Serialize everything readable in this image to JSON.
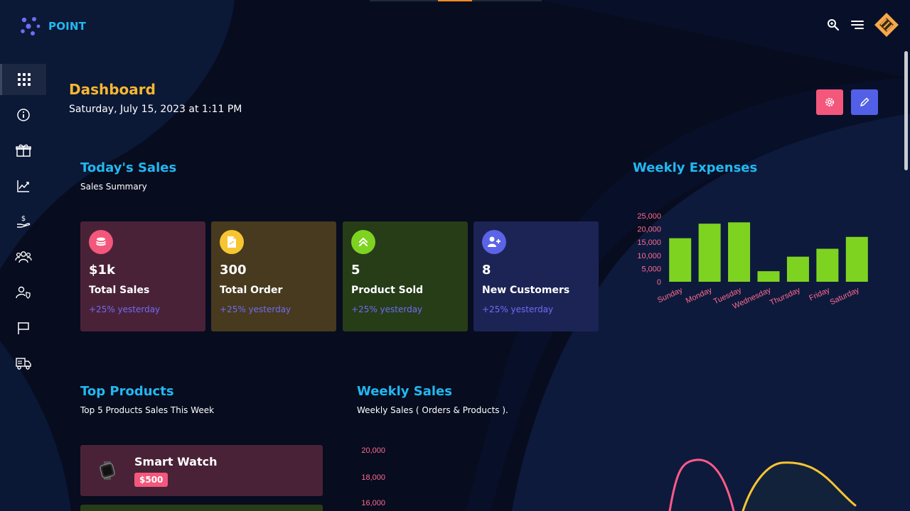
{
  "brand": {
    "name": "POINT"
  },
  "header": {
    "icons": [
      "search-icon",
      "menu-icon",
      "avatar-logo"
    ]
  },
  "sidebar": {
    "items": [
      {
        "icon": "grid-icon",
        "active": true
      },
      {
        "icon": "info-icon",
        "active": false
      },
      {
        "icon": "gift-icon",
        "active": false
      },
      {
        "icon": "chart-line-icon",
        "active": false
      },
      {
        "icon": "money-hand-icon",
        "active": false
      },
      {
        "icon": "users-icon",
        "active": false
      },
      {
        "icon": "user-shield-icon",
        "active": false
      },
      {
        "icon": "flag-icon",
        "active": false
      },
      {
        "icon": "truck-icon",
        "active": false
      }
    ]
  },
  "page": {
    "title": "Dashboard",
    "date": "Saturday, July 15, 2023 at 1:11 PM"
  },
  "todays_sales": {
    "title": "Today's Sales",
    "subtitle": "Sales Summary",
    "cards": [
      {
        "value": "$1k",
        "label": "Total Sales",
        "change": "+25% yesterday",
        "icon": "coins-icon",
        "icon_color": "#f4577c",
        "bg": "#4a2238"
      },
      {
        "value": "300",
        "label": "Total Order",
        "change": "+25% yesterday",
        "icon": "document-icon",
        "icon_color": "#f7c531",
        "bg": "#473a1e"
      },
      {
        "value": "5",
        "label": "Product Sold",
        "change": "+25% yesterday",
        "icon": "chevrons-up-icon",
        "icon_color": "#7ed321",
        "bg": "#263d18"
      },
      {
        "value": "8",
        "label": "New Customers",
        "change": "+25% yesterday",
        "icon": "user-plus-icon",
        "icon_color": "#5b63e6",
        "bg": "#1c2456"
      }
    ]
  },
  "weekly_expenses": {
    "title": "Weekly Expenses"
  },
  "top_products": {
    "title": "Top Products",
    "subtitle": "Top 5 Products Sales This Week",
    "items": [
      {
        "name": "Smart Watch",
        "price": "$500",
        "bg": "#4a2238"
      },
      {
        "name": "",
        "price": "",
        "bg": "#263d18"
      }
    ]
  },
  "weekly_sales": {
    "title": "Weekly Sales",
    "subtitle": "Weekly Sales ( Orders & Products )."
  },
  "chart_data": [
    {
      "type": "bar",
      "title": "Weekly Expenses",
      "categories": [
        "Sunday",
        "Monday",
        "Tuesday",
        "Wednesday",
        "Thursday",
        "Friday",
        "Saturday"
      ],
      "values": [
        16500,
        22000,
        22500,
        4000,
        9500,
        12500,
        17000
      ],
      "ylim": [
        0,
        25000
      ],
      "yticks": [
        "25,000",
        "20,000",
        "15,000",
        "10,000",
        "5,000",
        "0"
      ],
      "color": "#7ed321",
      "label_color": "#ff6b8e",
      "grid": false
    },
    {
      "type": "line",
      "title": "Weekly Sales",
      "yticks_visible": [
        "20,000",
        "18,000",
        "16,000"
      ],
      "series": [
        {
          "color": "#ff5a8a"
        },
        {
          "color": "#f7c531"
        }
      ]
    }
  ]
}
